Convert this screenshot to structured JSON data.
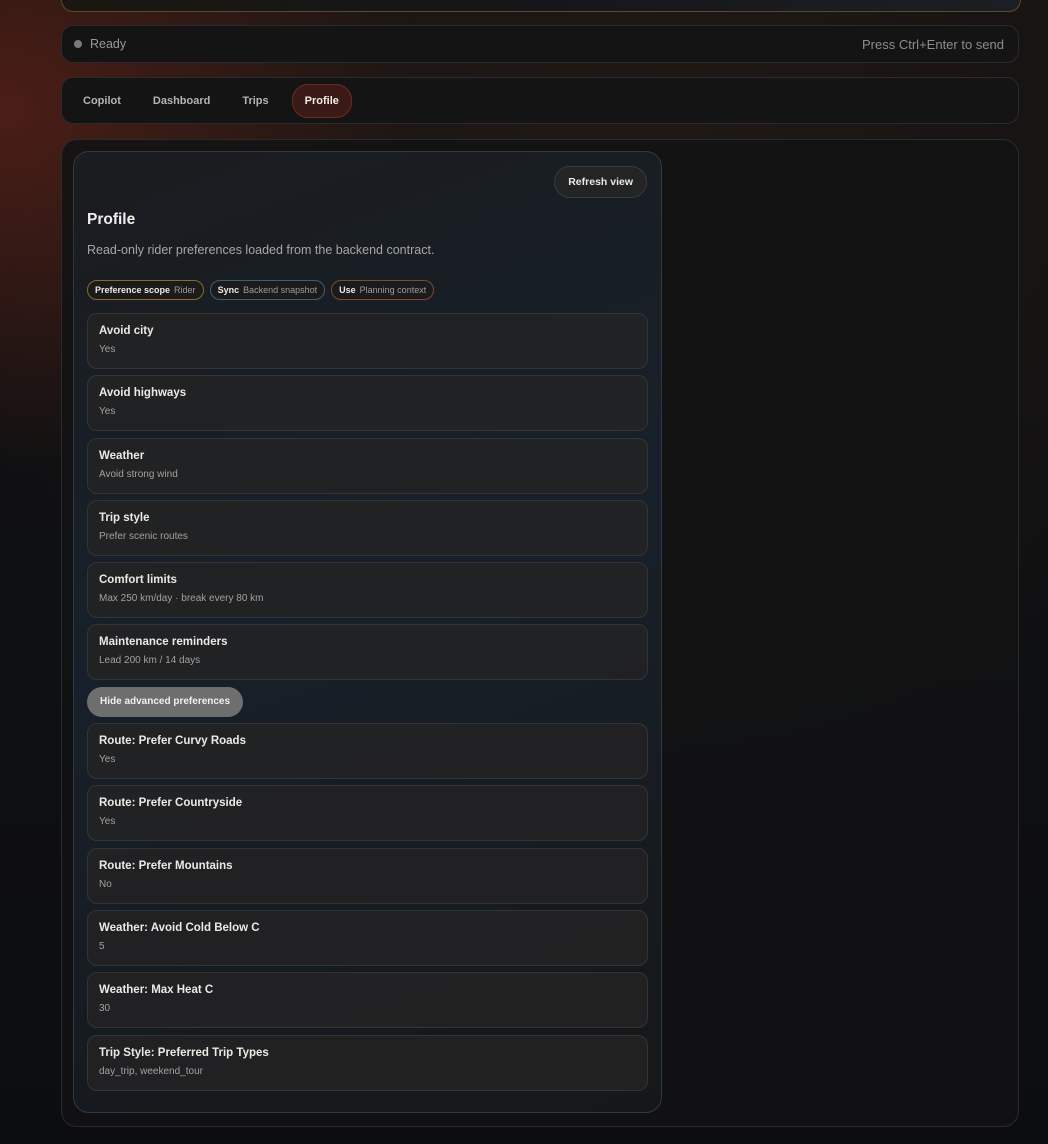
{
  "status": {
    "text": "Ready",
    "hint": "Press Ctrl+Enter to send"
  },
  "tabs": [
    {
      "label": "Copilot"
    },
    {
      "label": "Dashboard"
    },
    {
      "label": "Trips"
    },
    {
      "label": "Profile"
    }
  ],
  "profile": {
    "refresh_label": "Refresh view",
    "title": "Profile",
    "subtitle": "Read-only rider preferences loaded from the backend contract.",
    "chips": [
      {
        "key": "Preference scope",
        "value": "Rider"
      },
      {
        "key": "Sync",
        "value": "Backend snapshot"
      },
      {
        "key": "Use",
        "value": "Planning context"
      }
    ],
    "preferences": [
      {
        "label": "Avoid city",
        "value": "Yes"
      },
      {
        "label": "Avoid highways",
        "value": "Yes"
      },
      {
        "label": "Weather",
        "value": "Avoid strong wind"
      },
      {
        "label": "Trip style",
        "value": "Prefer scenic routes"
      },
      {
        "label": "Comfort limits",
        "value": "Max 250 km/day · break every 80 km"
      },
      {
        "label": "Maintenance reminders",
        "value": "Lead 200 km / 14 days"
      }
    ],
    "toggle_label": "Hide advanced preferences",
    "advanced": [
      {
        "label": "Route: Prefer Curvy Roads",
        "value": "Yes"
      },
      {
        "label": "Route: Prefer Countryside",
        "value": "Yes"
      },
      {
        "label": "Route: Prefer Mountains",
        "value": "No"
      },
      {
        "label": "Weather: Avoid Cold Below C",
        "value": "5"
      },
      {
        "label": "Weather: Max Heat C",
        "value": "30"
      },
      {
        "label": "Trip Style: Preferred Trip Types",
        "value": "day_trip, weekend_tour"
      }
    ]
  }
}
